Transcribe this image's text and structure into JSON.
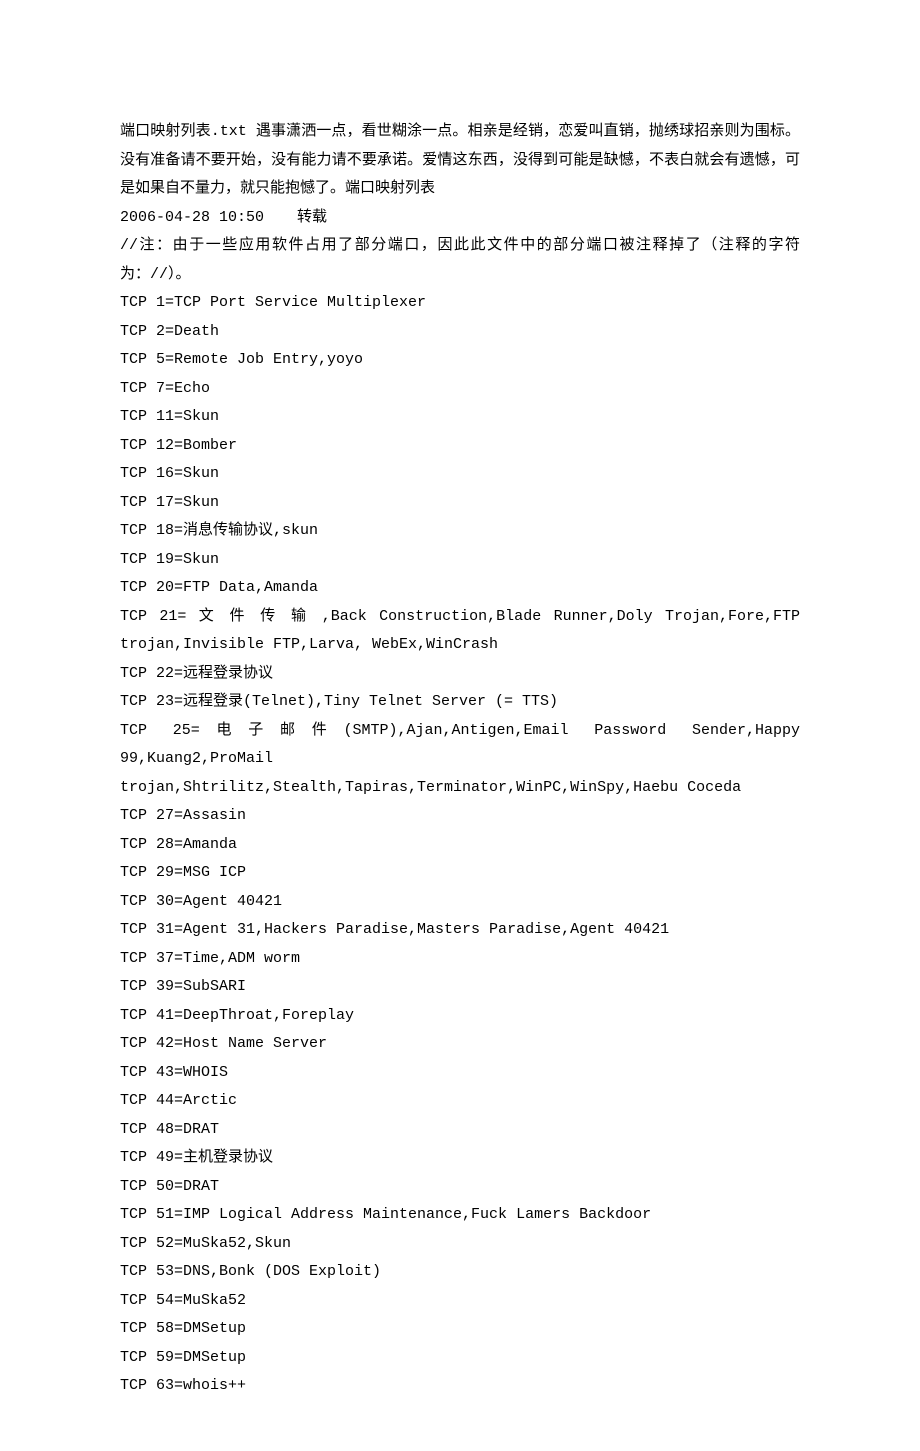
{
  "intro": "端口映射列表.txt 遇事潇洒一点，看世糊涂一点。相亲是经销，恋爱叫直销，抛绣球招亲则为围标。没有准备请不要开始，没有能力请不要承诺。爱情这东西，没得到可能是缺憾，不表白就会有遗憾，可是如果自不量力，就只能抱憾了。端口映射列表",
  "timestamp_label": "2006-04-28 10:50",
  "timestamp_value": "转载",
  "note": "//注：由于一些应用软件占用了部分端口，因此此文件中的部分端口被注释掉了（注释的字符为：//）。",
  "ports": [
    {
      "line": "TCP 1=TCP Port Service Multiplexer"
    },
    {
      "line": "TCP 2=Death"
    },
    {
      "line": "TCP 5=Remote Job Entry,yoyo"
    },
    {
      "line": "TCP 7=Echo"
    },
    {
      "line": "TCP 11=Skun"
    },
    {
      "line": "TCP 12=Bomber"
    },
    {
      "line": "TCP 16=Skun"
    },
    {
      "line": "TCP 17=Skun"
    },
    {
      "line": "TCP 18=消息传输协议,skun"
    },
    {
      "line": "TCP 19=Skun"
    },
    {
      "line": "TCP 20=FTP Data,Amanda"
    },
    {
      "line": "TCP 21= 文 件 传 输 ,Back Construction,Blade Runner,Doly Trojan,Fore,FTP trojan,Invisible FTP,Larva, WebEx,WinCrash"
    },
    {
      "line": "TCP 22=远程登录协议"
    },
    {
      "line": "TCP 23=远程登录(Telnet),Tiny Telnet Server (= TTS)"
    },
    {
      "line": "TCP 25=电子邮件(SMTP),Ajan,Antigen,Email Password Sender,Happy 99,Kuang2,ProMail trojan,Shtrilitz,Stealth,Tapiras,Terminator,WinPC,WinSpy,Haebu Coceda"
    },
    {
      "line": "TCP 27=Assasin"
    },
    {
      "line": "TCP 28=Amanda"
    },
    {
      "line": "TCP 29=MSG ICP"
    },
    {
      "line": "TCP 30=Agent 40421"
    },
    {
      "line": "TCP 31=Agent 31,Hackers Paradise,Masters Paradise,Agent 40421"
    },
    {
      "line": "TCP 37=Time,ADM worm"
    },
    {
      "line": "TCP 39=SubSARI"
    },
    {
      "line": "TCP 41=DeepThroat,Foreplay"
    },
    {
      "line": "TCP 42=Host Name Server"
    },
    {
      "line": "TCP 43=WHOIS"
    },
    {
      "line": "TCP 44=Arctic"
    },
    {
      "line": "TCP 48=DRAT"
    },
    {
      "line": "TCP 49=主机登录协议"
    },
    {
      "line": "TCP 50=DRAT"
    },
    {
      "line": "TCP 51=IMP Logical Address Maintenance,Fuck Lamers Backdoor"
    },
    {
      "line": "TCP 52=MuSka52,Skun"
    },
    {
      "line": "TCP 53=DNS,Bonk (DOS Exploit)"
    },
    {
      "line": "TCP 54=MuSka52"
    },
    {
      "line": "TCP 58=DMSetup"
    },
    {
      "line": "TCP 59=DMSetup"
    },
    {
      "line": "TCP 63=whois++"
    }
  ]
}
